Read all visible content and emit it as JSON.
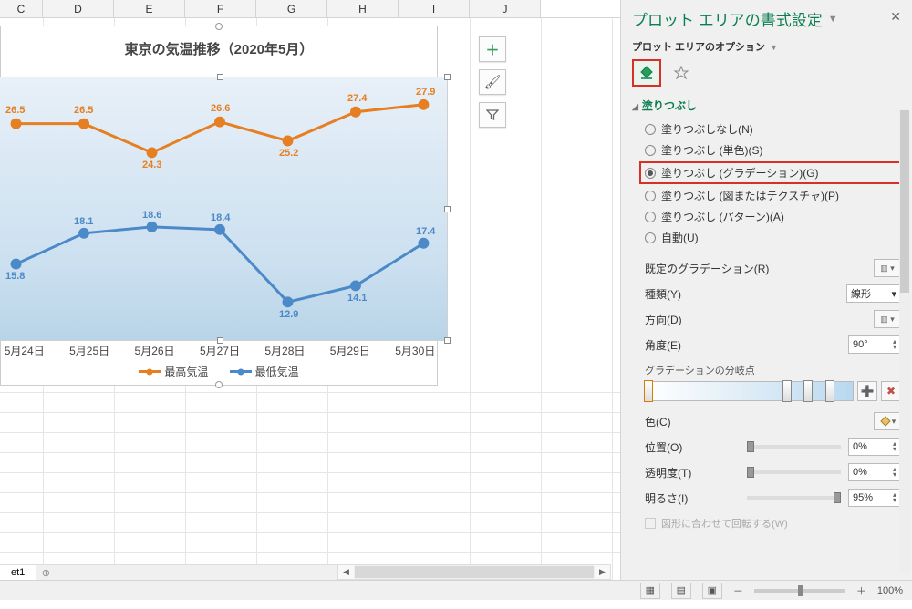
{
  "chart_data": {
    "type": "line",
    "title": "東京の気温推移（2020年5月）",
    "categories": [
      "5月24日",
      "5月25日",
      "5月26日",
      "5月27日",
      "5月28日",
      "5月29日",
      "5月30日"
    ],
    "series": [
      {
        "name": "最高気温",
        "values": [
          26.5,
          26.5,
          24.3,
          26.6,
          25.2,
          27.4,
          27.9
        ],
        "color": "#e67e22"
      },
      {
        "name": "最低気温",
        "values": [
          15.8,
          18.1,
          18.6,
          18.4,
          12.9,
          14.1,
          17.4
        ],
        "color": "#4b89c8"
      }
    ],
    "xlabel": "",
    "ylabel": "",
    "ylim": [
      10,
      30
    ]
  },
  "col_headers": [
    "C",
    "D",
    "E",
    "F",
    "G",
    "H",
    "I",
    "J"
  ],
  "side_btns": {
    "plus": "＋",
    "brush": "🖌",
    "filter": "▼"
  },
  "panel": {
    "title": "プロット エリアの書式設定",
    "subtitle": "プロット エリアのオプション",
    "section_fill": "塗りつぶし",
    "radios": {
      "none": "塗りつぶしなし(N)",
      "solid": "塗りつぶし (単色)(S)",
      "grad": "塗りつぶし (グラデーション)(G)",
      "tex": "塗りつぶし (図またはテクスチャ)(P)",
      "pat": "塗りつぶし (パターン)(A)",
      "auto": "自動(U)"
    },
    "controls": {
      "preset": "既定のグラデーション(R)",
      "type": "種類(Y)",
      "type_val": "線形",
      "dir": "方向(D)",
      "angle": "角度(E)",
      "angle_val": "90°",
      "stops": "グラデーションの分岐点",
      "color": "色(C)",
      "pos": "位置(O)",
      "pos_val": "0%",
      "trans": "透明度(T)",
      "trans_val": "0%",
      "bright": "明るさ(I)",
      "bright_val": "95%",
      "rotate": "図形に合わせて回転する(W)"
    }
  },
  "sheet_tab": "et1",
  "status": {
    "zoom": "100%",
    "minus": "－",
    "plus": "＋"
  }
}
